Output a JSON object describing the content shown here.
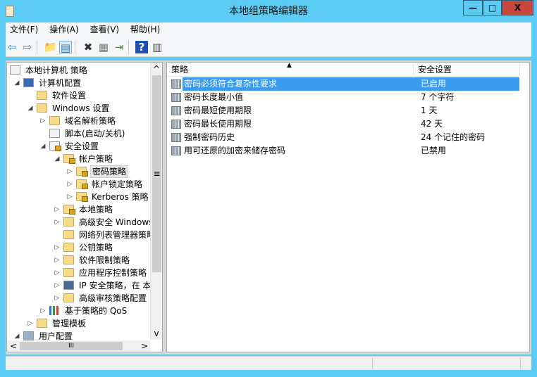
{
  "window": {
    "title": "本地组策略编辑器",
    "minimize": "—",
    "maximize": "□",
    "close": "X",
    "close_color": "#c7463d",
    "titlebar_color": "#5ccbf3"
  },
  "menu": [
    "文件(F)",
    "操作(A)",
    "查看(V)",
    "帮助(H)"
  ],
  "toolbar": [
    {
      "icon": "back-arrow-icon",
      "glyph": "⇦"
    },
    {
      "icon": "forward-arrow-icon",
      "glyph": "⇨"
    },
    {
      "icon": "up-folder-icon",
      "glyph": "📁"
    },
    {
      "icon": "show-hide-tree-icon",
      "glyph": "▤"
    },
    {
      "icon": "delete-icon",
      "glyph": "✖"
    },
    {
      "icon": "properties-icon",
      "glyph": "▦"
    },
    {
      "icon": "export-list-icon",
      "glyph": "⇥"
    },
    {
      "icon": "help-icon",
      "glyph": "?"
    },
    {
      "icon": "action-pane-icon",
      "glyph": "▥"
    }
  ],
  "tree": [
    {
      "label": "本地计算机 策略",
      "level": 0,
      "exp": "",
      "icon": "doc"
    },
    {
      "label": "计算机配置",
      "level": 1,
      "exp": "open",
      "icon": "computer"
    },
    {
      "label": "软件设置",
      "level": 2,
      "exp": "",
      "icon": "folder"
    },
    {
      "label": "Windows 设置",
      "level": 2,
      "exp": "open",
      "icon": "folder"
    },
    {
      "label": "域名解析策略",
      "level": 3,
      "exp": "closed",
      "icon": "folder"
    },
    {
      "label": "脚本(启动/关机)",
      "level": 3,
      "exp": "",
      "icon": "doc"
    },
    {
      "label": "安全设置",
      "level": 3,
      "exp": "open",
      "icon": "secure"
    },
    {
      "label": "帐户策略",
      "level": 4,
      "exp": "open",
      "icon": "lockfolder"
    },
    {
      "label": "密码策略",
      "level": 5,
      "exp": "closed",
      "icon": "lockfolder",
      "selected": true
    },
    {
      "label": "帐户锁定策略",
      "level": 5,
      "exp": "closed",
      "icon": "lockfolder"
    },
    {
      "label": "Kerberos 策略",
      "level": 5,
      "exp": "closed",
      "icon": "lockfolder"
    },
    {
      "label": "本地策略",
      "level": 4,
      "exp": "closed",
      "icon": "lockfolder"
    },
    {
      "label": "高级安全 Windows",
      "level": 4,
      "exp": "closed",
      "icon": "folder"
    },
    {
      "label": "网络列表管理器策略",
      "level": 4,
      "exp": "",
      "icon": "folder"
    },
    {
      "label": "公钥策略",
      "level": 4,
      "exp": "closed",
      "icon": "folder"
    },
    {
      "label": "软件限制策略",
      "level": 4,
      "exp": "closed",
      "icon": "folder"
    },
    {
      "label": "应用程序控制策略",
      "level": 4,
      "exp": "closed",
      "icon": "folder"
    },
    {
      "label": "IP 安全策略，在 本",
      "level": 4,
      "exp": "closed",
      "icon": "ipsec"
    },
    {
      "label": "高级审核策略配置",
      "level": 4,
      "exp": "closed",
      "icon": "folder"
    },
    {
      "label": "基于策略的 QoS",
      "level": 3,
      "exp": "closed",
      "icon": "chart"
    },
    {
      "label": "管理模板",
      "level": 2,
      "exp": "closed",
      "icon": "folder"
    },
    {
      "label": "用户配置",
      "level": 1,
      "exp": "open",
      "icon": "user"
    }
  ],
  "list": {
    "columns": [
      "策略",
      "安全设置"
    ],
    "rows": [
      {
        "name": "密码必须符合复杂性要求",
        "value": "已启用",
        "selected": true
      },
      {
        "name": "密码长度最小值",
        "value": "7 个字符"
      },
      {
        "name": "密码最短使用期限",
        "value": "1 天"
      },
      {
        "name": "密码最长使用期限",
        "value": "42 天"
      },
      {
        "name": "强制密码历史",
        "value": "24 个记住的密码"
      },
      {
        "name": "用可还原的加密来储存密码",
        "value": "已禁用"
      }
    ]
  },
  "scroll": {
    "up": "^",
    "down": "v",
    "left": "<",
    "right": ">",
    "thumb": "≡",
    "hthumb": "III"
  }
}
